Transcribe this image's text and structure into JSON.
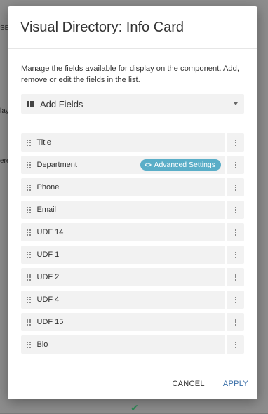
{
  "background": {
    "snippets": [
      "SE",
      "lay",
      "ere"
    ]
  },
  "modal": {
    "title": "Visual Directory: Info Card",
    "description": "Manage the fields available for display on the component. Add, remove or edit the fields in the list.",
    "add_fields_label": "Add Fields",
    "fields": [
      {
        "label": "Title"
      },
      {
        "label": "Department",
        "badge": "Advanced Settings"
      },
      {
        "label": "Phone"
      },
      {
        "label": "Email"
      },
      {
        "label": "UDF 14"
      },
      {
        "label": "UDF 1"
      },
      {
        "label": "UDF 2"
      },
      {
        "label": "UDF 4"
      },
      {
        "label": "UDF 15"
      },
      {
        "label": "Bio"
      }
    ],
    "cancel_label": "CANCEL",
    "apply_label": "APPLY"
  },
  "colors": {
    "accent_badge": "#5aaec8",
    "apply_link": "#3a6fa8",
    "row_background": "#f2f2f2"
  },
  "icons": {
    "add_fields": "column-bars-icon",
    "dropdown": "caret-down-icon",
    "drag": "drag-handle-icon",
    "row_menu": "vertical-ellipsis-icon",
    "badge": "code-brackets-icon"
  }
}
